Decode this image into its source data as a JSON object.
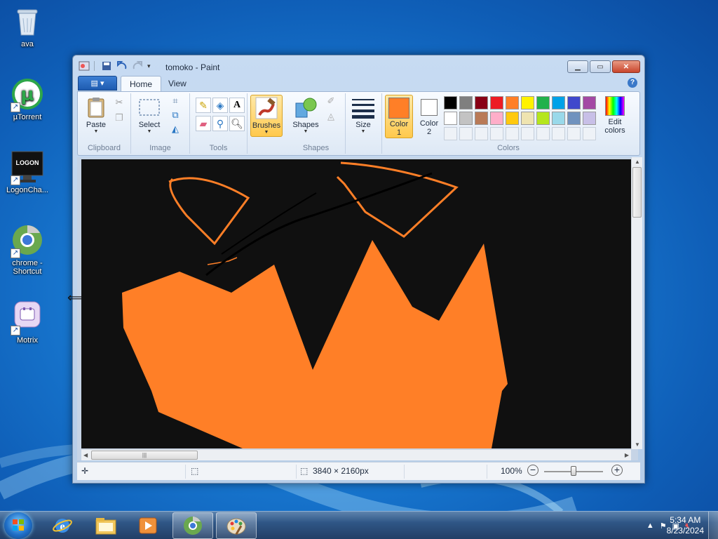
{
  "desktop": {
    "icons": [
      {
        "label": "ava",
        "icon": "recycle-bin-icon"
      },
      {
        "label": "µTorrent",
        "icon": "utorrent-icon"
      },
      {
        "label": "LogonCha...",
        "icon": "logon-changer-icon",
        "badge": "LOGON"
      },
      {
        "label": "chrome - Shortcut",
        "icon": "chrome-icon"
      },
      {
        "label": "Motrix",
        "icon": "motrix-icon"
      }
    ]
  },
  "window": {
    "title": "tomoko - Paint",
    "file_menu_label": "▤ ▾",
    "tabs": [
      {
        "label": "Home",
        "active": true
      },
      {
        "label": "View",
        "active": false
      }
    ],
    "help": "?",
    "controls": {
      "minimize": "▁",
      "maximize": "▭",
      "close": "✕"
    }
  },
  "ribbon": {
    "clipboard": {
      "label": "Clipboard",
      "paste": "Paste"
    },
    "image": {
      "label": "Image",
      "select": "Select"
    },
    "tools": {
      "label": "Tools",
      "text_glyph": "A"
    },
    "brushes": {
      "label": "Brushes"
    },
    "shapes": {
      "label": "Shapes",
      "shapes_btn": "Shapes"
    },
    "size": {
      "label": "Size"
    },
    "colors": {
      "label": "Colors",
      "color1_label_line1": "Color",
      "color1_label_line2": "1",
      "color2_label_line1": "Color",
      "color2_label_line2": "2",
      "edit_colors_line1": "Edit",
      "edit_colors_line2": "colors",
      "color1": "#ff7f27",
      "color2": "#ffffff",
      "palette_row1": [
        "#000000",
        "#7f7f7f",
        "#880015",
        "#ed1c24",
        "#ff7f27",
        "#fff200",
        "#22b14c",
        "#00a2e8",
        "#3f48cc",
        "#a349a4"
      ],
      "palette_row2": [
        "#ffffff",
        "#c3c3c3",
        "#b97a57",
        "#ffaec9",
        "#ffc90e",
        "#efe4b0",
        "#b5e61d",
        "#99d9ea",
        "#7092be",
        "#c8bfe7"
      ]
    }
  },
  "canvas": {
    "background": "#101010",
    "fill_color": "#ff7f27",
    "stroke_color": "#ff7f27",
    "line_color": "#000000"
  },
  "statusbar": {
    "dimensions": "3840 × 2160px",
    "zoom": "100%"
  },
  "taskbar": {
    "apps": [
      "start-orb",
      "internet-explorer",
      "file-explorer",
      "media-player",
      "chrome",
      "paint"
    ],
    "clock_time": "5:34 AM",
    "clock_date": "8/23/2024"
  }
}
